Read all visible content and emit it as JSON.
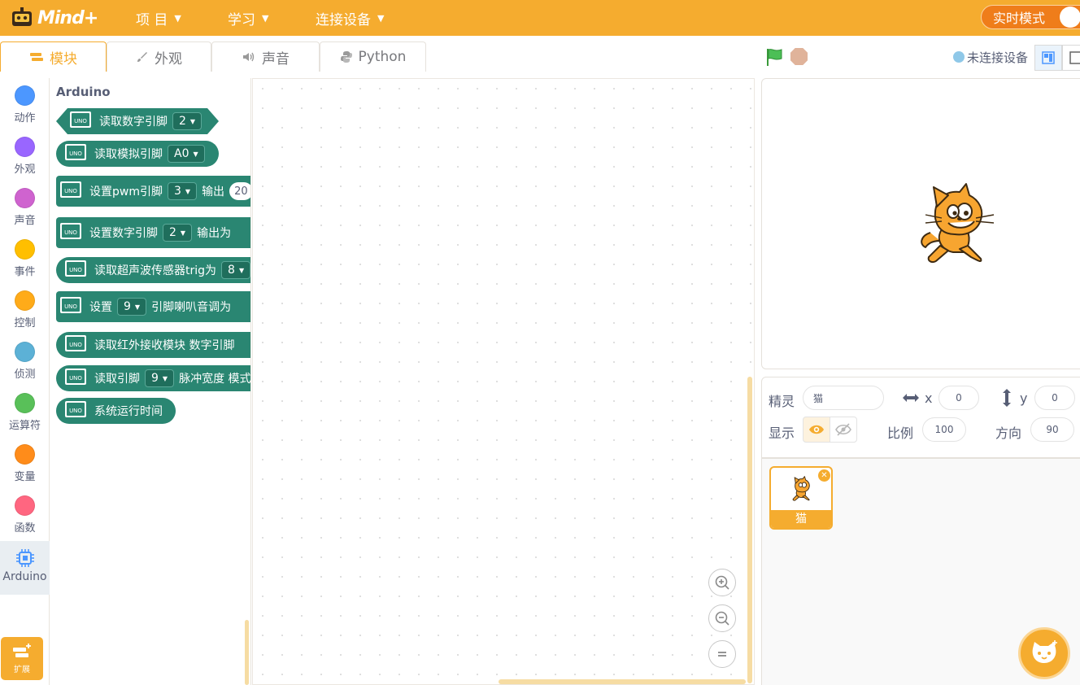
{
  "app": {
    "logo_text": "Mind+"
  },
  "menu": {
    "items": [
      {
        "label": "项 目"
      },
      {
        "label": "学习"
      },
      {
        "label": "连接设备"
      }
    ],
    "realtime_label": "实时模式"
  },
  "tabs": [
    {
      "label": "模块",
      "icon": "blocks-icon",
      "active": true
    },
    {
      "label": "外观",
      "icon": "brush-icon"
    },
    {
      "label": "声音",
      "icon": "speaker-icon"
    },
    {
      "label": "Python",
      "icon": "python-icon"
    }
  ],
  "device_status": "未连接设备",
  "categories": [
    {
      "label": "动作",
      "color": "#4c97ff"
    },
    {
      "label": "外观",
      "color": "#9966ff"
    },
    {
      "label": "声音",
      "color": "#cf63cf"
    },
    {
      "label": "事件",
      "color": "#ffbf00"
    },
    {
      "label": "控制",
      "color": "#ffab19"
    },
    {
      "label": "侦测",
      "color": "#5cb1d6"
    },
    {
      "label": "运算符",
      "color": "#59c059"
    },
    {
      "label": "变量",
      "color": "#ff8c1a"
    },
    {
      "label": "函数",
      "color": "#ff6680"
    },
    {
      "label": "Arduino",
      "color": "#2a8672",
      "selected": true
    }
  ],
  "extension_label": "扩展",
  "flyout": {
    "title": "Arduino",
    "blocks": {
      "b1": {
        "text": "读取数字引脚",
        "dd": "2"
      },
      "b2": {
        "text": "读取模拟引脚",
        "dd": "A0"
      },
      "b3": {
        "text": "设置pwm引脚",
        "dd": "3",
        "text2": "输出",
        "num": "20"
      },
      "b4": {
        "text": "设置数字引脚",
        "dd": "2",
        "text2": "输出为"
      },
      "b5": {
        "text": "读取超声波传感器trig为",
        "dd": "8"
      },
      "b6": {
        "text": "设置",
        "dd": "9",
        "text2": "引脚喇叭音调为"
      },
      "b7": {
        "text": "读取红外接收模块 数字引脚"
      },
      "b8": {
        "text": "读取引脚",
        "dd": "9",
        "text2": "脉冲宽度 模式"
      },
      "b9": {
        "text": "系统运行时间"
      }
    },
    "chip_label": "UNO"
  },
  "sprite_info": {
    "sprite_label": "精灵",
    "sprite_name": "猫",
    "x_label": "x",
    "x": "0",
    "y_label": "y",
    "y": "0",
    "show_label": "显示",
    "scale_label": "比例",
    "scale": "100",
    "direction_label": "方向",
    "direction": "90"
  },
  "sprites": [
    {
      "name": "猫"
    }
  ],
  "colors": {
    "accent": "#f5ac2f",
    "arduino": "#2a8672"
  }
}
